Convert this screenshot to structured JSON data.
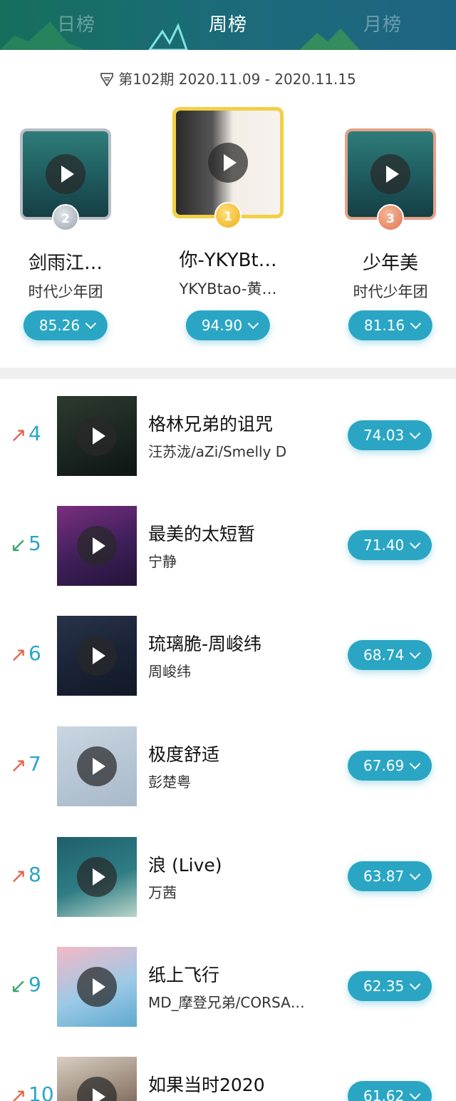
{
  "tabs": {
    "day": "日榜",
    "week": "周榜",
    "month": "月榜"
  },
  "period": "第102期 2020.11.09 - 2020.11.15",
  "podium": [
    {
      "rank": "2",
      "title": "剑雨江…",
      "artist": "时代少年团",
      "score": "85.26"
    },
    {
      "rank": "1",
      "title": "你-YKYBt…",
      "artist": "YKYBtao-黄…",
      "score": "94.90"
    },
    {
      "rank": "3",
      "title": "少年美",
      "artist": "时代少年团",
      "score": "81.16"
    }
  ],
  "list": [
    {
      "trend": "↗",
      "rank": "4",
      "title": "格林兄弟的诅咒",
      "artist": "汪苏泷/aZi/Smelly D",
      "score": "74.03"
    },
    {
      "trend": "↙",
      "rank": "5",
      "title": "最美的太短暂",
      "artist": "宁静",
      "score": "71.40"
    },
    {
      "trend": "↗",
      "rank": "6",
      "title": "琉璃脆-周峻纬",
      "artist": "周峻纬",
      "score": "68.74"
    },
    {
      "trend": "↗",
      "rank": "7",
      "title": "极度舒适",
      "artist": "彭楚粤",
      "score": "67.69"
    },
    {
      "trend": "↗",
      "rank": "8",
      "title": "浪 (Live)",
      "artist": "万茜",
      "score": "63.87"
    },
    {
      "trend": "↙",
      "rank": "9",
      "title": "纸上飞行",
      "artist": "MD_摩登兄弟/CORSA…",
      "score": "62.35"
    },
    {
      "trend": "↗",
      "rank": "10",
      "title": "如果当时2020",
      "artist": "",
      "score": "61.62"
    }
  ],
  "colors": {
    "accent": "#2aa6c4",
    "up": "#e3654a",
    "down": "#3aa56c",
    "header": "#1b6b78"
  }
}
